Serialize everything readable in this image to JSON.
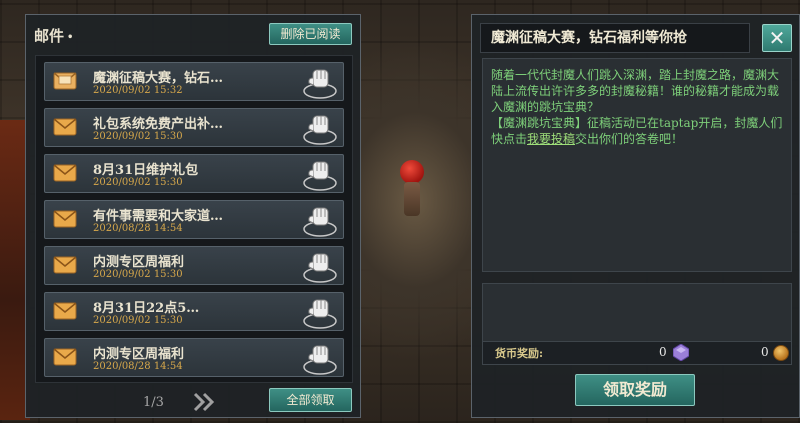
{
  "mail_panel": {
    "title": "邮件",
    "title_marker": "•",
    "delete_read_label": "删除已阅读",
    "claim_all_label": "全部领取",
    "pager": "1/3",
    "next_icon": "double-chevron-right",
    "items": [
      {
        "title": "魔渊征稿大赛，钻石…",
        "date": "2020/09/02  15:32",
        "opened": true
      },
      {
        "title": "礼包系统免费产出补…",
        "date": "2020/09/02  15:30",
        "opened": false
      },
      {
        "title": "8月31日维护礼包",
        "date": "2020/09/02  15:30",
        "opened": false
      },
      {
        "title": "有件事需要和大家道…",
        "date": "2020/08/28  14:54",
        "opened": false
      },
      {
        "title": "内测专区周福利",
        "date": "2020/09/02  15:30",
        "opened": false
      },
      {
        "title": "8月31日22点5…",
        "date": "2020/09/02  15:30",
        "opened": false
      },
      {
        "title": "内测专区周福利",
        "date": "2020/08/28  14:54",
        "opened": false
      }
    ]
  },
  "detail_panel": {
    "title": "魔渊征稿大赛，钻石福利等你抢",
    "close_icon": "close-x",
    "content_p1": "随着一代代封魔人们跳入深渊，踏上封魔之路，魔渊大陆上流传出许许多多的封魔秘籍！谁的秘籍才能成为载入魔渊的跳坑宝典？",
    "content_p2_before": "【魔渊跳坑宝典】征稿活动已在taptap开启，封魔人们快点击",
    "content_link": "我要投稿",
    "content_p2_after": "交出你们的答卷吧！",
    "currency_label": "货币奖励:",
    "gem_value": "0",
    "coin_value": "0",
    "receive_label": "领取奖励"
  },
  "colors": {
    "accent_teal": "#2f7a70",
    "content_green": "#7ed07a",
    "date_gold": "#d7a84b"
  }
}
